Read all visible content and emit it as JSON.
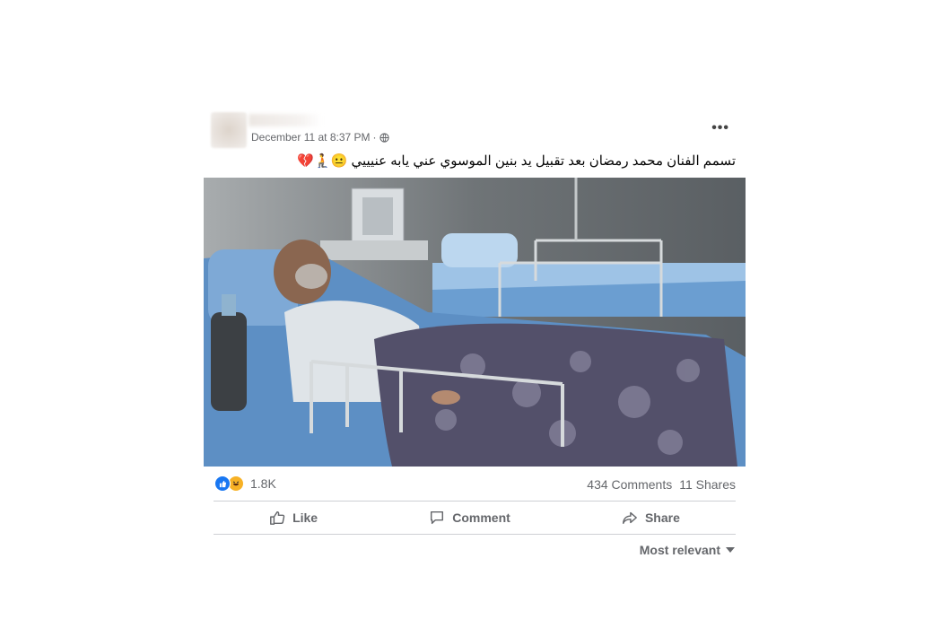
{
  "post": {
    "timestamp": "December 11 at 8:37 PM",
    "separator": "·",
    "privacy_icon": "globe-icon",
    "more_icon": "more-options-icon",
    "more_label": "•••",
    "caption": "تسمم الفنان محمد رمضان بعد تقبيل يد بنين الموسوي عني يابه عنيييي 😐🧎💔",
    "photo_alt": ""
  },
  "stats": {
    "reaction_icons": [
      "like-icon",
      "haha-icon"
    ],
    "reaction_count": "1.8K",
    "comments": "434 Comments",
    "shares": "11 Shares"
  },
  "actions": {
    "like": "Like",
    "comment": "Comment",
    "share": "Share"
  },
  "comments_sort": {
    "label": "Most relevant"
  },
  "colors": {
    "like_blue": "#1877f2",
    "haha_yellow": "#f7b125",
    "secondary_text": "#65676b"
  }
}
